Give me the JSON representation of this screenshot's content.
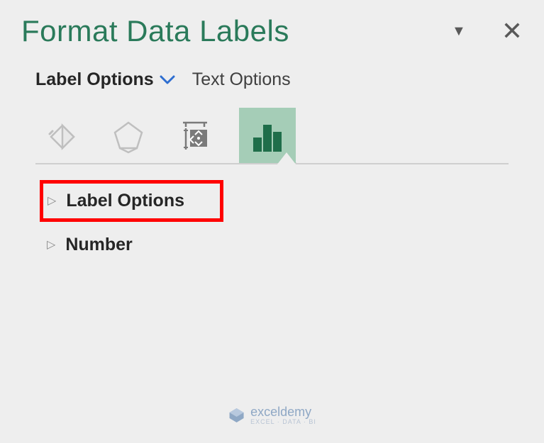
{
  "header": {
    "title": "Format Data Labels"
  },
  "tabs": {
    "label_options": "Label Options",
    "text_options": "Text Options"
  },
  "icon_tabs": {
    "fill": "fill-line-icon",
    "effects": "effects-icon",
    "size": "size-properties-icon",
    "options": "label-options-icon"
  },
  "sections": {
    "label_options": "Label Options",
    "number": "Number"
  },
  "watermark": {
    "name": "exceldemy",
    "sub": "EXCEL · DATA · BI"
  }
}
